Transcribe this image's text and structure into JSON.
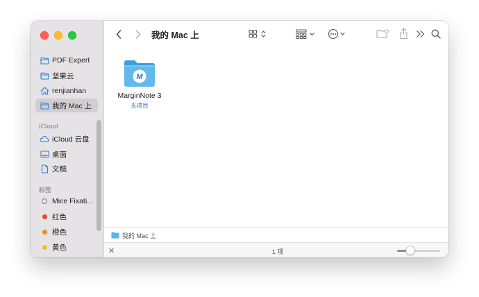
{
  "window": {
    "title": "我的 Mac 上"
  },
  "sidebar": {
    "favorites": [
      {
        "label": "PDF Expert",
        "icon": "folder-icon"
      },
      {
        "label": "坚果云",
        "icon": "folder-icon"
      },
      {
        "label": "renjianhan",
        "icon": "home-icon"
      },
      {
        "label": "我的 Mac 上",
        "icon": "folder-icon",
        "selected": true
      }
    ],
    "icloud_title": "iCloud",
    "icloud": [
      {
        "label": "iCloud 云盘",
        "icon": "cloud-icon"
      },
      {
        "label": "桌面",
        "icon": "desktop-icon"
      },
      {
        "label": "文稿",
        "icon": "document-icon"
      }
    ],
    "tags_title": "标签",
    "tags": [
      {
        "label": "Mice Fixati...",
        "color": ""
      },
      {
        "label": "红色",
        "color": "#f0403a"
      },
      {
        "label": "橙色",
        "color": "#f08a24"
      },
      {
        "label": "黄色",
        "color": "#f2c21b"
      }
    ]
  },
  "content": {
    "items": [
      {
        "name": "MarginNote 3",
        "subtitle": "无项目",
        "icon": "marginnote-folder-icon",
        "badge": "M"
      }
    ]
  },
  "pathbar": {
    "label": "我的 Mac 上",
    "icon": "folder-icon"
  },
  "status": {
    "count": "1 项",
    "zoom": 0.25
  },
  "colors": {
    "accent": "#2f6fd0",
    "folder": "#5fb5ea",
    "sidebar_bg": "#e6e3e6"
  }
}
